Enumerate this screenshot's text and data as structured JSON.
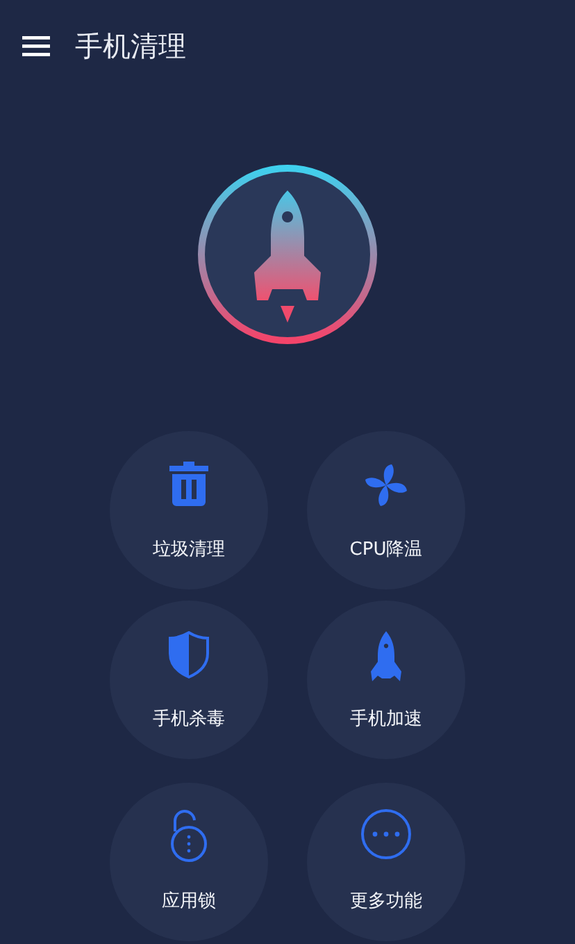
{
  "app_bar": {
    "title": "手机清理"
  },
  "tools": [
    {
      "label": "垃圾清理",
      "kind": "trash"
    },
    {
      "label": "CPU降温",
      "kind": "fan"
    },
    {
      "label": "手机杀毒",
      "kind": "shield"
    },
    {
      "label": "手机加速",
      "kind": "rocket"
    },
    {
      "label": "应用锁",
      "kind": "lock"
    },
    {
      "label": "更多功能",
      "kind": "more"
    }
  ]
}
